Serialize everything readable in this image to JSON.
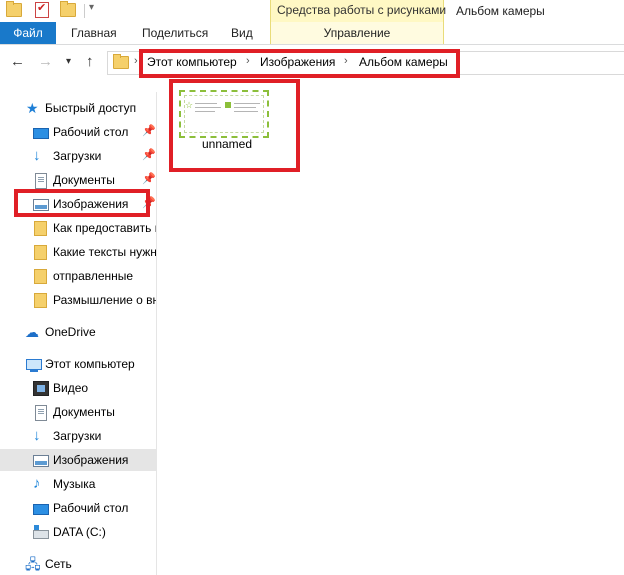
{
  "window": {
    "title": "Альбом камеры"
  },
  "contextual_tools": {
    "group_label": "Средства работы с рисунками",
    "tab_label": "Управление"
  },
  "ribbon": {
    "tabs": [
      "Файл",
      "Главная",
      "Поделиться",
      "Вид"
    ]
  },
  "address_bar": {
    "crumbs": [
      "Этот компьютер",
      "Изображения",
      "Альбом камеры"
    ]
  },
  "nav_pane": {
    "quick_access": "Быстрый доступ",
    "quick_items": [
      "Рабочий стол",
      "Загрузки",
      "Документы",
      "Изображения"
    ],
    "recent_folders": [
      "Как предоставить г",
      "Какие тексты нужн",
      "отправленные",
      "Размышление о вн"
    ],
    "onedrive": "OneDrive",
    "this_pc": "Этот компьютер",
    "pc_items": [
      "Видео",
      "Документы",
      "Загрузки",
      "Изображения",
      "Музыка",
      "Рабочий стол",
      "DATA (C:)"
    ],
    "network": "Сеть"
  },
  "content": {
    "files": [
      {
        "name": "unnamed",
        "icon": "image-thumbnail"
      }
    ]
  },
  "colors": {
    "file_tab": "#1979ca",
    "highlight": "#e01f26",
    "contextual_band": "#fff8c4"
  }
}
